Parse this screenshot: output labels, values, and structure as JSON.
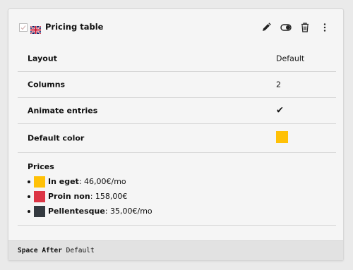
{
  "header": {
    "title": "Pricing table",
    "icons": [
      "content-type-icon",
      "uk-flag-icon",
      "edit-icon",
      "toggle-icon",
      "delete-icon",
      "more-icon"
    ]
  },
  "rows": [
    {
      "label": "Layout",
      "value": "Default"
    },
    {
      "label": "Columns",
      "value": "2"
    },
    {
      "label": "Animate entries",
      "value": "✔"
    },
    {
      "label": "Default color",
      "color": "#ffc107"
    }
  ],
  "prices": {
    "heading": "Prices",
    "items": [
      {
        "name": "In eget",
        "price": ": 46,00€/mo",
        "color": "#ffc107"
      },
      {
        "name": "Proin non",
        "price": ": 158,00€",
        "color": "#dc3545"
      },
      {
        "name": "Pellentesque",
        "price": ": 35,00€/mo",
        "color": "#343a40"
      }
    ]
  },
  "footer": {
    "label": "Space After",
    "value": " Default"
  }
}
